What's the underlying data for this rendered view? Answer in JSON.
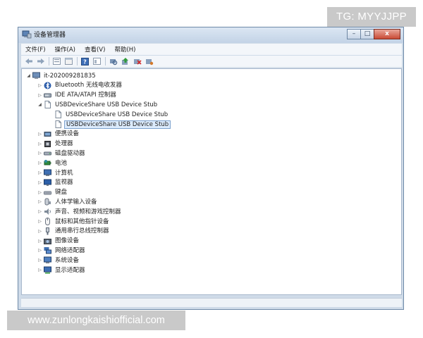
{
  "watermark_top": "TG: MYYJJPP",
  "watermark_bottom": "www.zunlongkaishiofficial.com",
  "window": {
    "title": "设备管理器",
    "controls": {
      "minimize": "–",
      "maximize": "□",
      "close": "x"
    }
  },
  "menu": [
    "文件(F)",
    "操作(A)",
    "查看(V)",
    "帮助(H)"
  ],
  "toolbar": [
    "back-arrow-icon",
    "forward-arrow-icon",
    "properties-icon",
    "view-icon",
    "help-icon",
    "console-icon",
    "scan-hardware-icon",
    "update-driver-icon",
    "uninstall-icon",
    "enable-icon"
  ],
  "tree": {
    "root": "it-202009281835",
    "nodes": [
      {
        "label": "Bluetooth 无线电收发器",
        "icon": "bluetooth-icon",
        "expander": "▷"
      },
      {
        "label": "IDE ATA/ATAPI 控制器",
        "icon": "ide-controller-icon",
        "expander": "▷"
      },
      {
        "label": "USBDeviceShare USB Device Stub",
        "icon": "usb-device-icon",
        "expander": "◢",
        "children": [
          {
            "label": "USBDeviceShare USB Device Stub",
            "icon": "usb-device-icon"
          },
          {
            "label": "USBDeviceShare USB Device Stub",
            "icon": "usb-device-icon",
            "selected": true
          }
        ]
      },
      {
        "label": "便携设备",
        "icon": "portable-device-icon",
        "expander": "▷"
      },
      {
        "label": "处理器",
        "icon": "processor-icon",
        "expander": "▷"
      },
      {
        "label": "磁盘驱动器",
        "icon": "disk-drive-icon",
        "expander": "▷"
      },
      {
        "label": "电池",
        "icon": "battery-icon",
        "expander": "▷"
      },
      {
        "label": "计算机",
        "icon": "computer-icon",
        "expander": "▷"
      },
      {
        "label": "监视器",
        "icon": "monitor-icon",
        "expander": "▷"
      },
      {
        "label": "键盘",
        "icon": "keyboard-icon",
        "expander": "▷"
      },
      {
        "label": "人体学输入设备",
        "icon": "hid-icon",
        "expander": "▷"
      },
      {
        "label": "声音、视频和游戏控制器",
        "icon": "sound-icon",
        "expander": "▷"
      },
      {
        "label": "鼠标和其他指针设备",
        "icon": "mouse-icon",
        "expander": "▷"
      },
      {
        "label": "通用串行总线控制器",
        "icon": "usb-controller-icon",
        "expander": "▷"
      },
      {
        "label": "图像设备",
        "icon": "camera-icon",
        "expander": "▷"
      },
      {
        "label": "网络适配器",
        "icon": "network-adapter-icon",
        "expander": "▷"
      },
      {
        "label": "系统设备",
        "icon": "system-device-icon",
        "expander": "▷"
      },
      {
        "label": "显示适配器",
        "icon": "display-adapter-icon",
        "expander": "▷"
      }
    ]
  },
  "colors": {
    "selection_bg": "#dcebfc",
    "selection_border": "#7da2ce",
    "title_bg": "#cfdbe8"
  }
}
